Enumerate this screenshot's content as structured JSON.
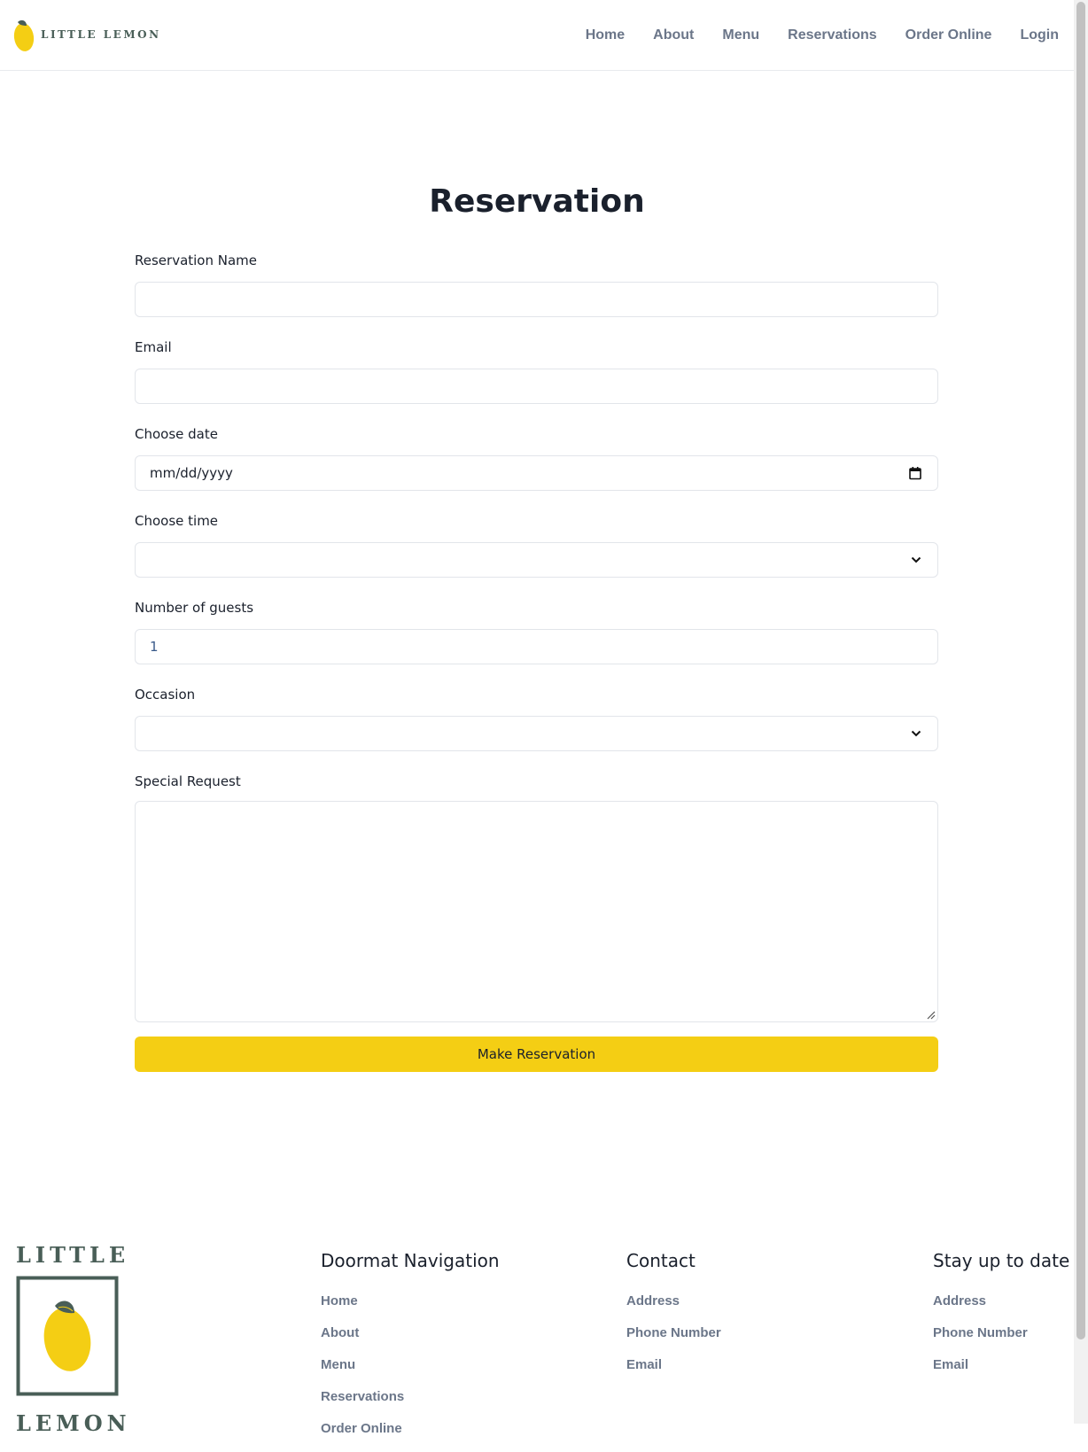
{
  "brand": {
    "logo_text": "LITTLE LEMON",
    "footer_logo_top": "LITTLE",
    "footer_logo_bottom": "LEMON",
    "colors": {
      "green": "#495e57",
      "yellow": "#f4ce14",
      "nav_text": "#6b7689"
    }
  },
  "nav": {
    "items": [
      {
        "label": "Home"
      },
      {
        "label": "About"
      },
      {
        "label": "Menu"
      },
      {
        "label": "Reservations"
      },
      {
        "label": "Order Online"
      },
      {
        "label": "Login"
      }
    ]
  },
  "form": {
    "title": "Reservation",
    "name": {
      "label": "Reservation Name",
      "value": ""
    },
    "email": {
      "label": "Email",
      "value": ""
    },
    "date": {
      "label": "Choose date",
      "placeholder": "mm/dd/yyyy",
      "icon": "calendar-icon"
    },
    "time": {
      "label": "Choose time",
      "value": "",
      "icon": "chevron-down-icon"
    },
    "guests": {
      "label": "Number of guests",
      "value": "1"
    },
    "occasion": {
      "label": "Occasion",
      "value": "",
      "icon": "chevron-down-icon"
    },
    "request": {
      "label": "Special Request",
      "value": ""
    },
    "submit_label": "Make Reservation"
  },
  "footer": {
    "columns": [
      {
        "heading": "Doormat Navigation",
        "links": [
          "Home",
          "About",
          "Menu",
          "Reservations",
          "Order Online"
        ]
      },
      {
        "heading": "Contact",
        "links": [
          "Address",
          "Phone Number",
          "Email"
        ]
      },
      {
        "heading": "Stay up to date",
        "links": [
          "Address",
          "Phone Number",
          "Email"
        ]
      }
    ]
  }
}
